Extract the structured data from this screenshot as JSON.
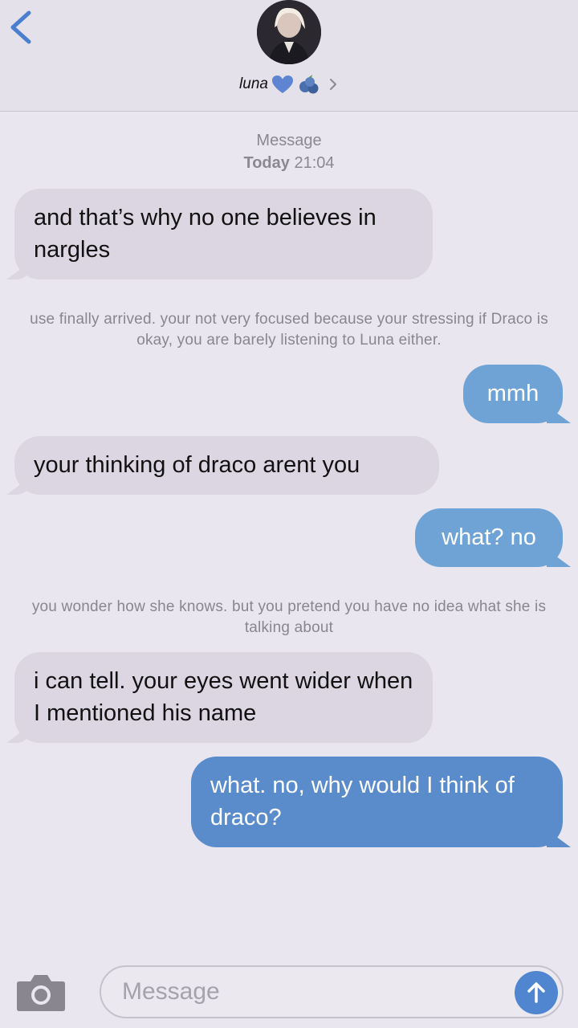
{
  "header": {
    "contact_name": "luna",
    "back_icon": "chevron-left-icon",
    "heart_color": "#5f84d2"
  },
  "thread": {
    "label": "Message",
    "date": "Today",
    "time": "21:04"
  },
  "messages": [
    {
      "from": "contact",
      "text": "and that’s why no one believes in nargles"
    },
    {
      "from": "narration",
      "text": "use finally arrived. your not very focused because your stressing if Draco is okay, you are barely listening to Luna either."
    },
    {
      "from": "me",
      "text": "mmh"
    },
    {
      "from": "contact",
      "text": "your thinking of draco arent you"
    },
    {
      "from": "me",
      "text": "what? no"
    },
    {
      "from": "narration",
      "text": "you wonder how she knows. but you pretend you have no idea what she is talking about"
    },
    {
      "from": "contact",
      "text": "i can tell. your eyes went wider when I mentioned his name"
    },
    {
      "from": "me",
      "text": "what. no, why would I think of draco?"
    }
  ],
  "composer": {
    "placeholder": "Message",
    "value": "",
    "camera_icon": "camera-icon",
    "send_icon": "arrow-up-icon"
  },
  "colors": {
    "background": "#e9e6ef",
    "incoming_bubble": "#dcd6e2",
    "outgoing_bubble": "#6fa3d6",
    "accent": "#4f86cf"
  }
}
